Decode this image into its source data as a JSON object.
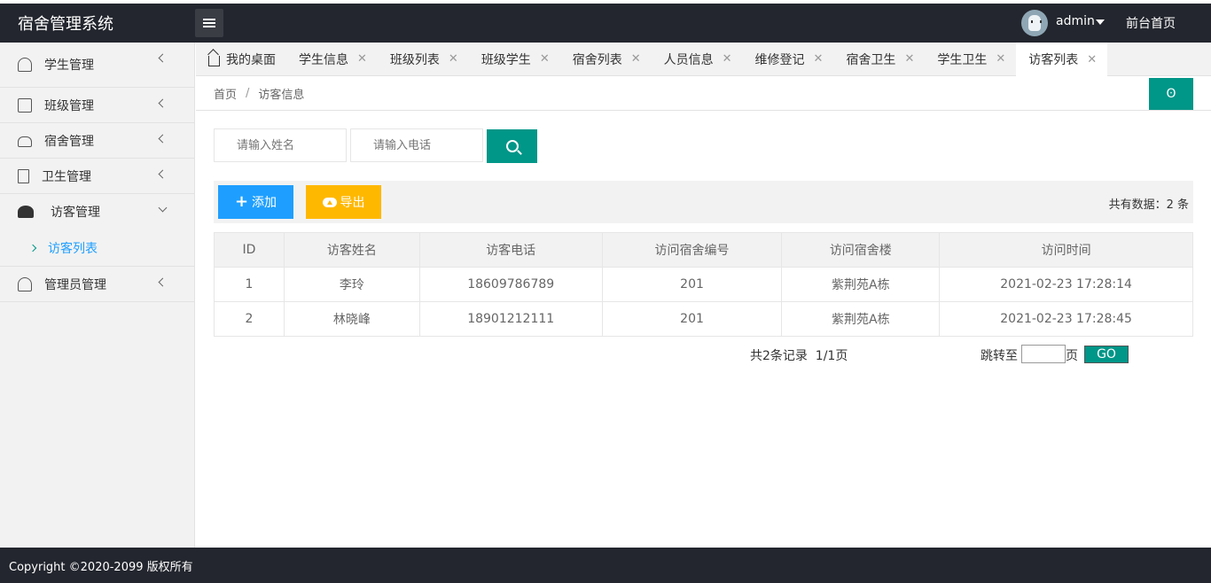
{
  "app": {
    "title": "宿舍管理系统"
  },
  "header": {
    "username": "admin",
    "home_link": "前台首页"
  },
  "sidebar": {
    "items": [
      {
        "label": "学生管理",
        "icon": "user-icon"
      },
      {
        "label": "班级管理",
        "icon": "class-icon"
      },
      {
        "label": "宿舍管理",
        "icon": "sofa-icon"
      },
      {
        "label": "卫生管理",
        "icon": "document-icon"
      },
      {
        "label": "访客管理",
        "icon": "people-icon",
        "expanded": true
      },
      {
        "label": "访客列表",
        "sub": true,
        "active": true
      },
      {
        "label": "管理员管理",
        "icon": "admin-icon"
      }
    ]
  },
  "tabs": [
    {
      "label": "我的桌面",
      "closable": false
    },
    {
      "label": "学生信息"
    },
    {
      "label": "班级列表"
    },
    {
      "label": "班级学生"
    },
    {
      "label": "宿舍列表"
    },
    {
      "label": "人员信息"
    },
    {
      "label": "维修登记"
    },
    {
      "label": "宿舍卫生"
    },
    {
      "label": "学生卫生"
    },
    {
      "label": "访客列表",
      "active": true
    }
  ],
  "tab_close": "✕",
  "breadcrumb": {
    "home": "首页",
    "separator": "/",
    "current": "访客信息"
  },
  "refresh_label": "ʘ",
  "search": {
    "name_placeholder": "请输入姓名",
    "phone_placeholder": "请输入电话"
  },
  "toolbar": {
    "add_label": "添加",
    "export_label": "导出",
    "count_text": "共有数据：2 条"
  },
  "table": {
    "columns": [
      "ID",
      "访客姓名",
      "访客电话",
      "访问宿舍编号",
      "访问宿舍楼",
      "访问时间"
    ],
    "rows": [
      [
        "1",
        "李玲",
        "18609786789",
        "201",
        "紫荆苑A栋",
        "2021-02-23 17:28:14"
      ],
      [
        "2",
        "林晓峰",
        "18901212111",
        "201",
        "紫荆苑A栋",
        "2021-02-23 17:28:45"
      ]
    ]
  },
  "pager": {
    "info": "共2条记录  1/1页",
    "jump_label": "跳转至",
    "page_label": "页",
    "go_label": "GO"
  },
  "footer": {
    "copyright": "Copyright ©2020-2099 版权所有"
  },
  "colors": {
    "header_bg": "#23262e",
    "primary": "#009688",
    "blue": "#1e9fff",
    "orange": "#ffb800"
  }
}
